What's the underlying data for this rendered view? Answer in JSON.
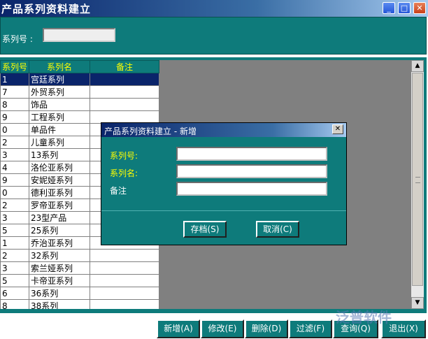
{
  "window": {
    "title": "产品系列资料建立",
    "min_glyph": "_",
    "max_glyph": "□",
    "close_glyph": "✕"
  },
  "filter": {
    "label": "系列号 :",
    "value": ""
  },
  "grid": {
    "headers": [
      "系列号",
      "系列名",
      "备注"
    ],
    "rows": [
      [
        "1",
        "宫廷系列",
        ""
      ],
      [
        "7",
        "外贸系列",
        ""
      ],
      [
        "8",
        "饰品",
        ""
      ],
      [
        "9",
        "工程系列",
        ""
      ],
      [
        "0",
        "单品件",
        ""
      ],
      [
        "2",
        "儿童系列",
        ""
      ],
      [
        "3",
        "13系列",
        ""
      ],
      [
        "4",
        "洛伦亚系列",
        ""
      ],
      [
        "9",
        "安妮娅系列",
        ""
      ],
      [
        "0",
        "德利亚系列",
        ""
      ],
      [
        "2",
        "罗帝亚系列",
        ""
      ],
      [
        "3",
        "23型产品",
        ""
      ],
      [
        "5",
        "25系列",
        ""
      ],
      [
        "1",
        "乔治亚系列",
        ""
      ],
      [
        "2",
        "32系列",
        ""
      ],
      [
        "3",
        "索兰娅系列",
        ""
      ],
      [
        "5",
        "卡帝亚系列",
        ""
      ],
      [
        "6",
        "36系列",
        ""
      ],
      [
        "8",
        "38系列",
        ""
      ]
    ],
    "selected_index": 0,
    "scroll_up_glyph": "▲",
    "scroll_down_glyph": "▼"
  },
  "dialog": {
    "title": "产品系列资料建立 - 新增",
    "close_glyph": "✕",
    "fields": {
      "series_no_label": "系列号:",
      "series_no_value": "",
      "series_name_label": "系列名:",
      "series_name_value": "",
      "remark_label": "备注",
      "remark_value": ""
    },
    "save_label": "存档(S)",
    "cancel_label": "取消(C)"
  },
  "toolbar": {
    "add_label": "新增(A)",
    "edit_label": "修改(E)",
    "delete_label": "删除(D)",
    "filter_label": "过滤(F)",
    "query_label": "查询(Q)",
    "exit_label": "退出(X)"
  },
  "watermark": {
    "text": "泛普软件"
  }
}
